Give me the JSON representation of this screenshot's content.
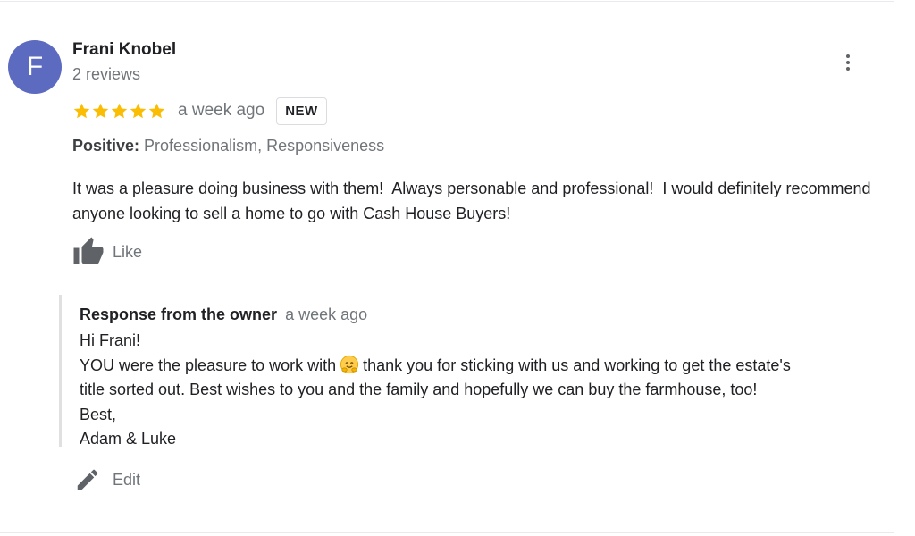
{
  "review": {
    "avatar_letter": "F",
    "avatar_color": "#5c6bc0",
    "reviewer_name": "Frani Knobel",
    "reviewer_meta": "2 reviews",
    "rating": 5,
    "star_color": "#fbbc04",
    "time": "a week ago",
    "badge": "NEW",
    "positive_label": "Positive:",
    "positive_values": "Professionalism, Responsiveness",
    "text": "It was a pleasure doing business with them!  Always personable and professional!  I would definitely recommend anyone looking to sell a home to go with Cash House Buyers!",
    "like_label": "Like",
    "more_icon": "more-vert-icon"
  },
  "owner_response": {
    "title": "Response from the owner",
    "time": "a week ago",
    "lines": {
      "l1": "Hi Frani!",
      "l2a": "YOU were the pleasure to work with",
      "l2_emoji": "hugging-face-emoji",
      "l2b": "thank you for sticking with us and working to get the estate's",
      "l3": "title sorted out. Best wishes to you and the family and hopefully we can buy the farmhouse, too!",
      "l4": "Best,",
      "l5": "Adam & Luke"
    },
    "edit_label": "Edit"
  }
}
